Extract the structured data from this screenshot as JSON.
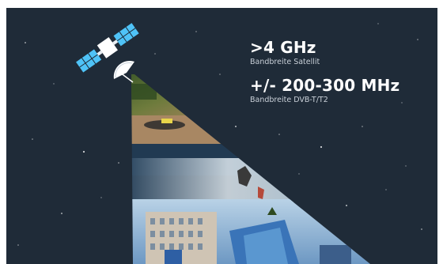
{
  "stats": [
    {
      "value": ">4 GHz",
      "label": "Bandbreite Satellit"
    },
    {
      "value": "+/- 200-300 MHz",
      "label": "Bandbreite DVB-T/T2"
    }
  ],
  "colors": {
    "background": "#1f2b38",
    "satellite": "#4fc3f7",
    "text": "#ffffff"
  },
  "icons": [
    "satellite-icon"
  ]
}
